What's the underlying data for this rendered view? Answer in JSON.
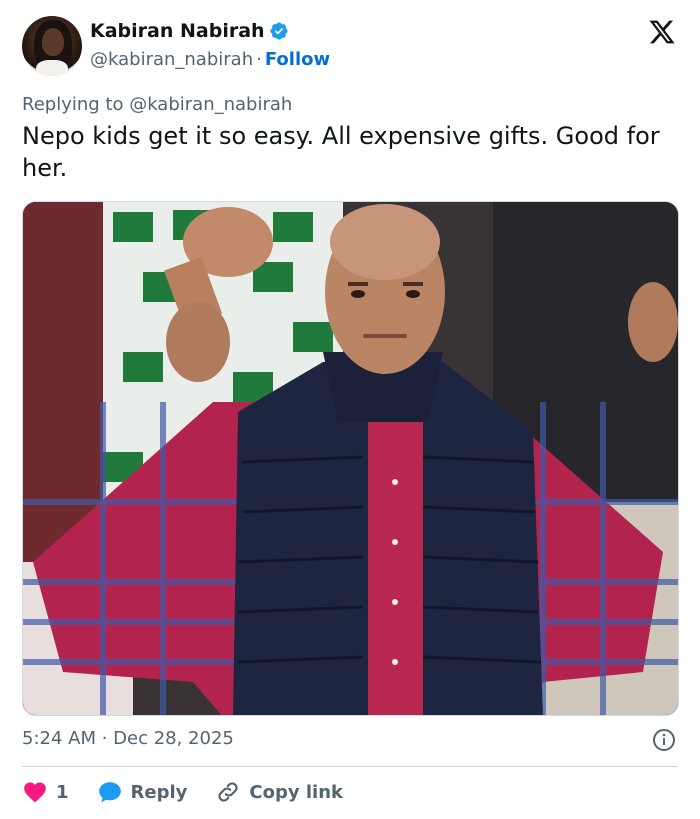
{
  "author": {
    "name": "Kabiran Nabirah",
    "handle": "@kabiran_nabirah",
    "separator": "·",
    "follow_label": "Follow",
    "verified_color": "#1d9bf0"
  },
  "brand": {
    "logo_icon": "x-logo-icon"
  },
  "replying_to": "Replying to @kabiran_nabirah",
  "tweet_text": "Nepo kids get it so easy. All expensive gifts. Good for her.",
  "media": {
    "icon": "photo",
    "description_icon": "image"
  },
  "timestamp": "5:24 AM · Dec 28, 2025",
  "actions": {
    "like_count": "1",
    "reply_label": "Reply",
    "copy_link_label": "Copy link"
  },
  "colors": {
    "like": "#f91880",
    "reply": "#1d9bf0",
    "follow": "#006fd6",
    "muted": "#536471"
  }
}
